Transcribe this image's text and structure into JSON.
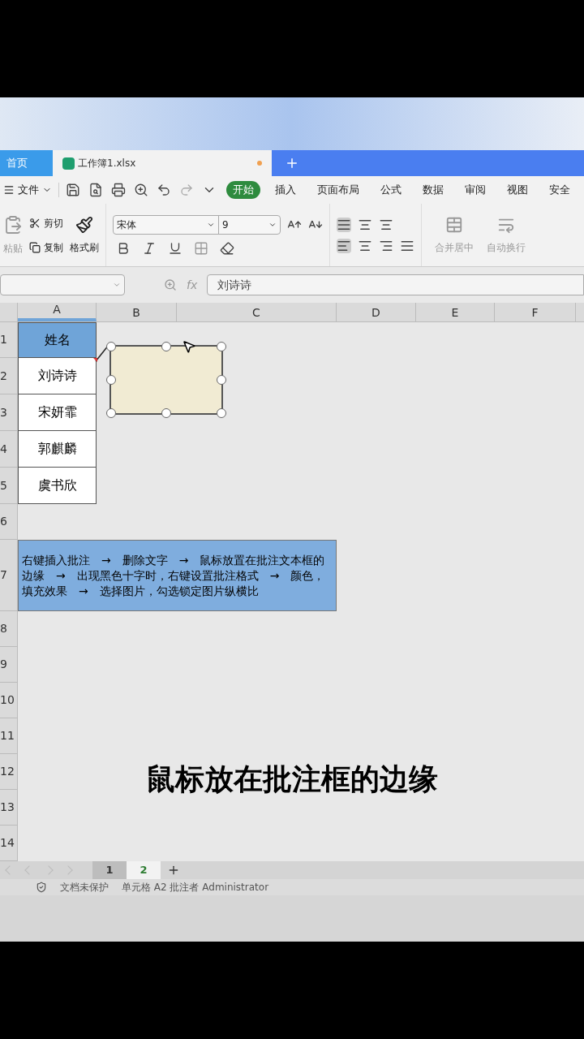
{
  "tabs": [
    {
      "label": "首页",
      "kind": "home",
      "selected": false
    },
    {
      "label": "工作簿1.xlsx",
      "kind": "file",
      "selected": true,
      "unsaved": true
    }
  ],
  "menu": {
    "file": "文件",
    "tabs": [
      {
        "label": "开始",
        "selected": true
      },
      {
        "label": "插入",
        "selected": false
      },
      {
        "label": "页面布局",
        "selected": false
      },
      {
        "label": "公式",
        "selected": false
      },
      {
        "label": "数据",
        "selected": false
      },
      {
        "label": "审阅",
        "selected": false
      },
      {
        "label": "视图",
        "selected": false
      },
      {
        "label": "安全",
        "selected": false
      }
    ]
  },
  "ribbon": {
    "paste": "粘贴",
    "cut": "剪切",
    "copy": "复制",
    "format_painter": "格式刷",
    "font": "宋体",
    "font_size": "9",
    "merge": "合并居中",
    "wrap": "自动换行"
  },
  "formula_bar": {
    "fx": "fx",
    "value": "刘诗诗"
  },
  "columns": [
    {
      "label": "A",
      "selected": true
    },
    {
      "label": "B",
      "selected": false
    },
    {
      "label": "C",
      "selected": false
    },
    {
      "label": "D",
      "selected": false
    },
    {
      "label": "E",
      "selected": false
    },
    {
      "label": "F",
      "selected": false
    }
  ],
  "rows": [
    {
      "number": "1",
      "kind": "header",
      "text": "姓名"
    },
    {
      "number": "2",
      "kind": "name",
      "text": "刘诗诗"
    },
    {
      "number": "3",
      "kind": "name",
      "text": "宋妍霏"
    },
    {
      "number": "4",
      "kind": "name",
      "text": "郭麒麟"
    },
    {
      "number": "5",
      "kind": "name",
      "text": "虞书欣"
    },
    {
      "number": "6",
      "kind": "empty"
    },
    {
      "number": "7",
      "kind": "note",
      "text": "右键插入批注　→　删除文字　→　鼠标放置在批注文本框的边缘　→　出现黑色十字时，右键设置批注格式　→　颜色，填充效果　→　选择图片，勾选锁定图片纵横比"
    },
    {
      "number": "8",
      "kind": "empty"
    },
    {
      "number": "9",
      "kind": "empty"
    },
    {
      "number": "10",
      "kind": "empty"
    },
    {
      "number": "11",
      "kind": "empty"
    },
    {
      "number": "12",
      "kind": "empty"
    },
    {
      "number": "13",
      "kind": "empty"
    },
    {
      "number": "14",
      "kind": "empty"
    }
  ],
  "sheet_tabs": [
    {
      "label": "1",
      "selected": false
    },
    {
      "label": "2",
      "selected": true
    }
  ],
  "status_bar": [
    "文档未保护",
    "单元格 A2 批注者 Administrator"
  ],
  "caption": "鼠标放在批注框的边缘"
}
